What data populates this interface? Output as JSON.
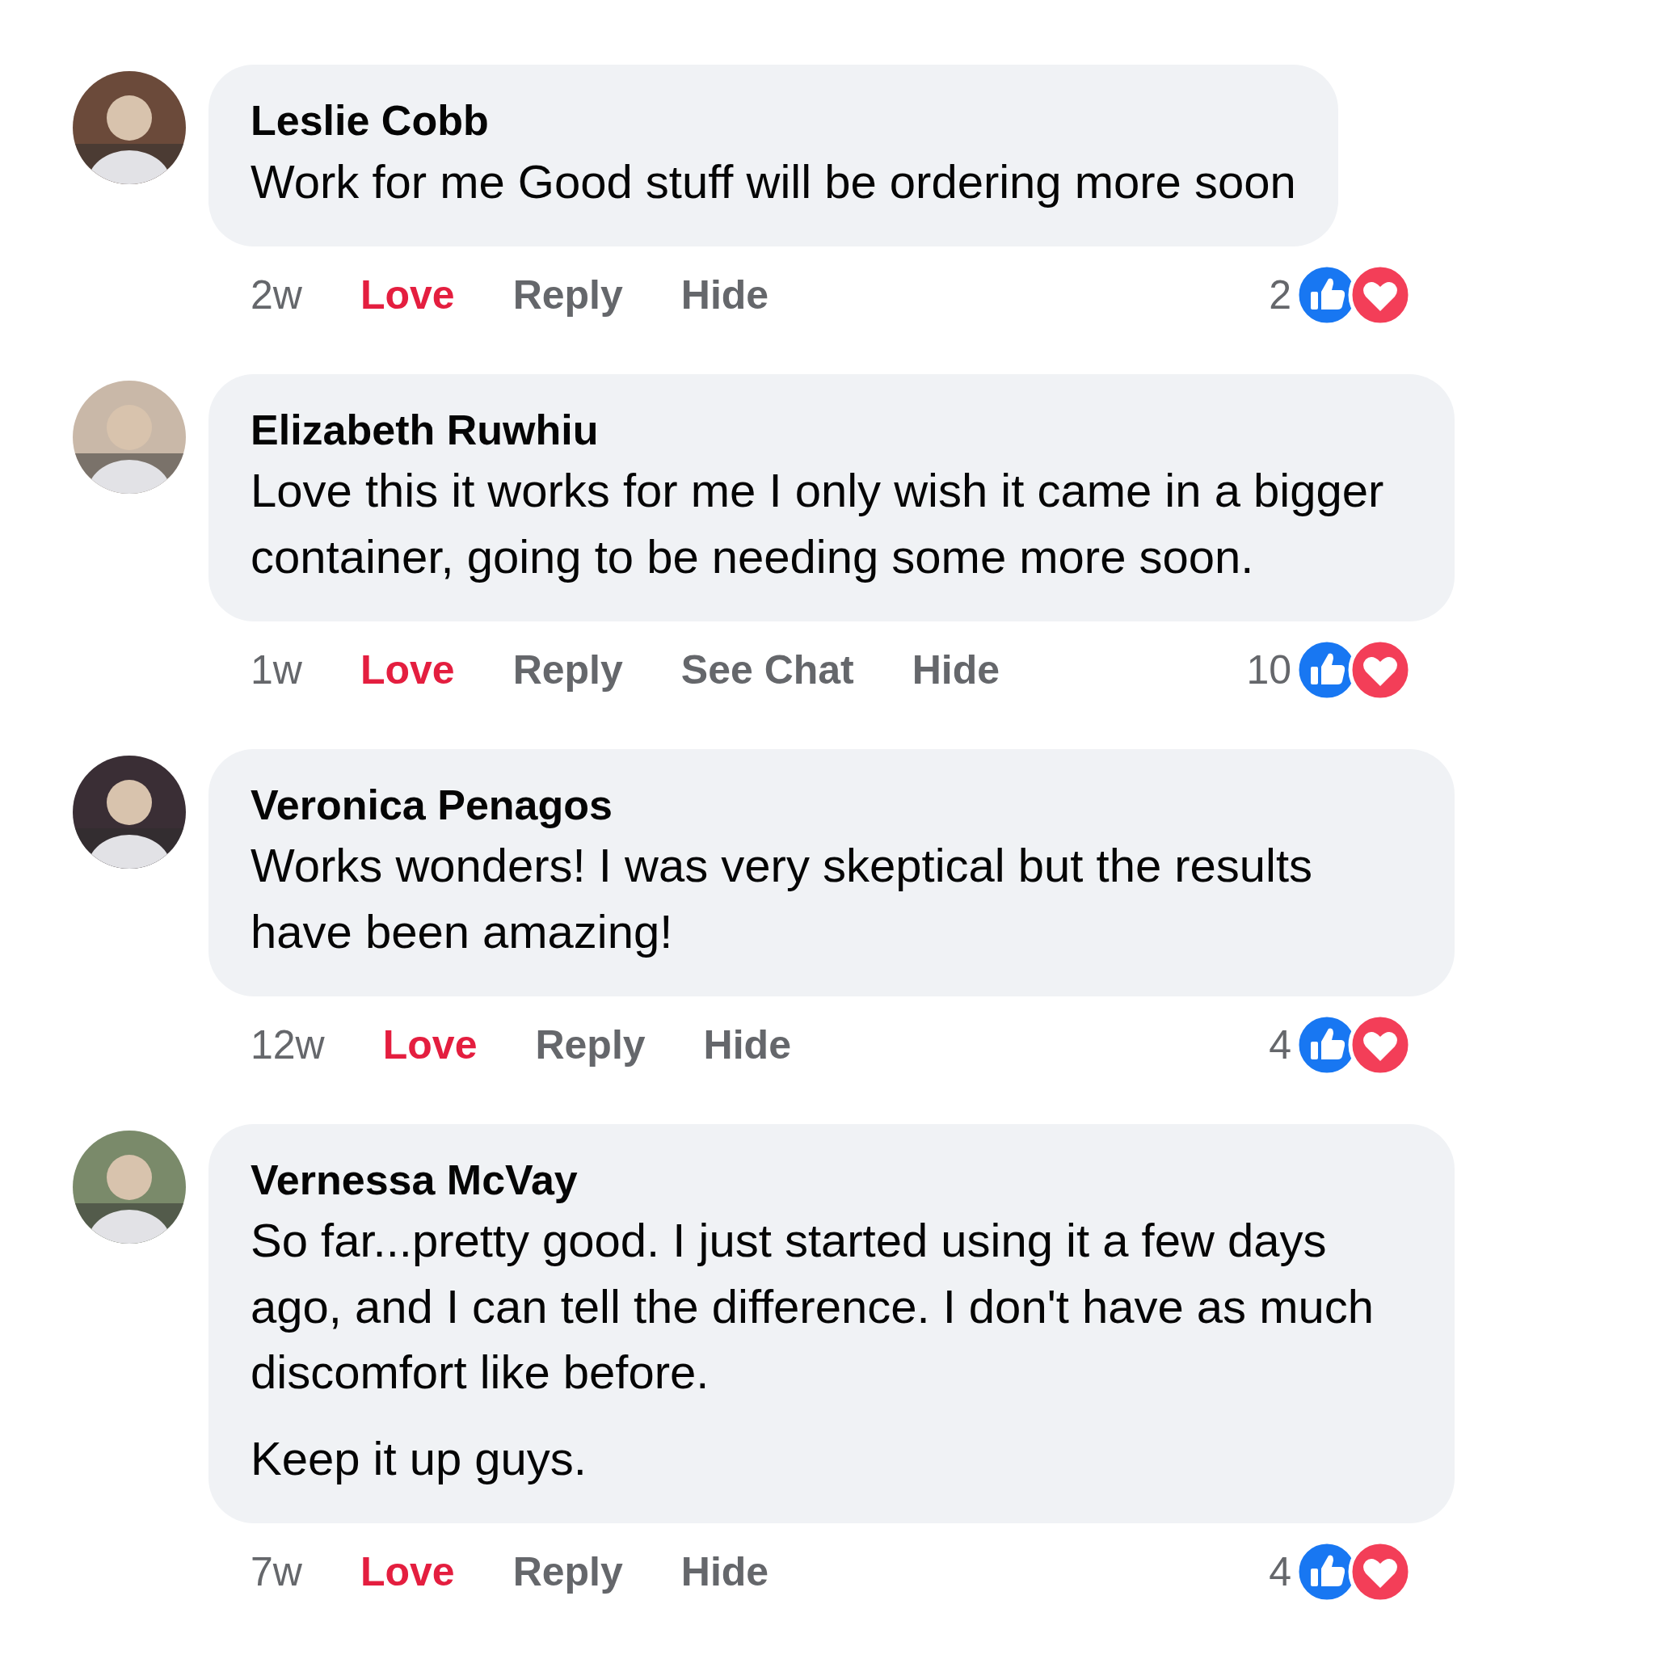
{
  "comments": [
    {
      "author": "Leslie Cobb",
      "paragraphs": [
        "Work for me Good stuff will be ordering more soon"
      ],
      "actions": [
        {
          "kind": "time",
          "label": "2w"
        },
        {
          "kind": "love",
          "label": "Love",
          "reacted": true
        },
        {
          "kind": "link",
          "label": "Reply"
        },
        {
          "kind": "link",
          "label": "Hide"
        }
      ],
      "reaction_count": "2"
    },
    {
      "author": "Elizabeth Ruwhiu",
      "paragraphs": [
        "Love this it works for me I only wish it came in a bigger container, going to be needing some more soon."
      ],
      "actions": [
        {
          "kind": "time",
          "label": "1w"
        },
        {
          "kind": "love",
          "label": "Love",
          "reacted": true
        },
        {
          "kind": "link",
          "label": "Reply"
        },
        {
          "kind": "link",
          "label": "See Chat"
        },
        {
          "kind": "link",
          "label": "Hide"
        }
      ],
      "reaction_count": "10"
    },
    {
      "author": "Veronica Penagos",
      "paragraphs": [
        "Works wonders! I was very skeptical but the results have been amazing!"
      ],
      "actions": [
        {
          "kind": "time",
          "label": "12w"
        },
        {
          "kind": "love",
          "label": "Love",
          "reacted": true
        },
        {
          "kind": "link",
          "label": "Reply"
        },
        {
          "kind": "link",
          "label": "Hide"
        }
      ],
      "reaction_count": "4"
    },
    {
      "author": "Vernessa McVay",
      "paragraphs": [
        "So far...pretty good. I just started using it a few days ago, and I can tell the difference. I don't have as much discomfort like before.",
        "Keep it up guys."
      ],
      "actions": [
        {
          "kind": "time",
          "label": "7w"
        },
        {
          "kind": "love",
          "label": "Love",
          "reacted": true
        },
        {
          "kind": "link",
          "label": "Reply"
        },
        {
          "kind": "link",
          "label": "Hide"
        }
      ],
      "reaction_count": "4"
    }
  ]
}
